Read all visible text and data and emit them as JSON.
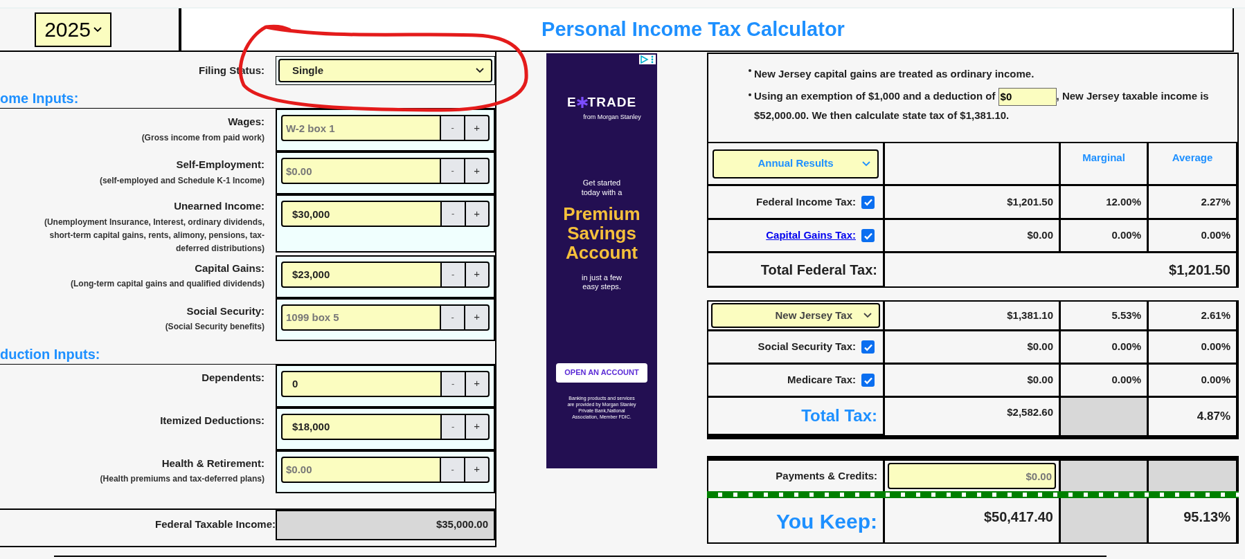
{
  "year_select": {
    "value": "2025"
  },
  "title": "Personal Income Tax Calculator",
  "filing_status": {
    "label": "Filing Status:",
    "value": "Single"
  },
  "sections": [
    {
      "heading": "ome Inputs:",
      "fields": [
        {
          "label": "Wages:",
          "sublabel": "(Gross income from paid work)",
          "placeholder": "W-2 box 1",
          "buttons": [
            "-",
            "+"
          ]
        },
        {
          "label": "Self-Employment:",
          "sublabel": "(self-employed and Schedule K-1 Income)",
          "placeholder": "$0.00",
          "buttons": [
            "-",
            "+"
          ]
        },
        {
          "label": "Unearned Income:",
          "sublabel": "(Unemployment Insurance, Interest, ordinary dividends, short-term capital gains, rents, alimony, pensions, tax-deferred distributions)",
          "value": "$30,000",
          "buttons": [
            "-",
            "+"
          ]
        },
        {
          "label": "Capital Gains:",
          "sublabel": "(Long-term capital gains and qualified dividends)",
          "value": "$23,000",
          "buttons": [
            "-",
            "+"
          ]
        },
        {
          "label": "Social Security:",
          "sublabel": "(Social Security benefits)",
          "placeholder": "1099 box 5",
          "buttons": [
            "-",
            "+"
          ]
        }
      ]
    },
    {
      "heading": "duction Inputs:",
      "fields": [
        {
          "label": "Dependents:",
          "value": "0",
          "buttons": [
            "-",
            "+"
          ]
        },
        {
          "label": "Itemized Deductions:",
          "value": "$18,000",
          "buttons": [
            "-",
            "+"
          ]
        },
        {
          "label": "Health & Retirement:",
          "sublabel": "(Health premiums and tax-deferred plans)",
          "placeholder": "$0.00",
          "buttons": [
            "-",
            "+"
          ]
        }
      ]
    }
  ],
  "federal_taxable_income": {
    "label": "Federal Taxable Income:",
    "value": "$35,000.00"
  },
  "ad": {
    "logo_start": "E",
    "logo_end": "TRADE",
    "logo_tagline": "from Morgan Stanley",
    "intro": "Get started today with a",
    "headline": "Premium Savings Account",
    "subline": "in just a few easy steps.",
    "button": "OPEN AN ACCOUNT",
    "disclaimer": "Banking products and services are provided by Morgan Stanley Private Bank,National Association, Member FDIC."
  },
  "notes": [
    {
      "text": "New Jersey capital gains are treated as ordinary income."
    },
    {
      "text": "Using an exemption of $1,000 and a deduction of",
      "input_value": "$0",
      "after": ", New Jersey taxable income is $52,000.00. We then calculate state tax of $1,381.10."
    }
  ],
  "results_select": "Annual Results",
  "columns": [
    "Marginal",
    "Average"
  ],
  "federal_rows": [
    {
      "kind": "checkbox",
      "label": "Federal Income Tax:",
      "checked": true,
      "amount": "$1,201.50",
      "marginal": "12.00%",
      "average": "2.27%"
    },
    {
      "kind": "link",
      "label": "Capital Gains Tax:",
      "checked": true,
      "amount": "$0.00",
      "marginal": "0.00%",
      "average": "0.00%"
    }
  ],
  "total_federal": {
    "label": "Total Federal Tax:",
    "value": "$1,201.50"
  },
  "state_rows": [
    {
      "kind": "select",
      "label": "New Jersey Tax",
      "amount": "$1,381.10",
      "marginal": "5.53%",
      "average": "2.61%"
    },
    {
      "kind": "checkbox",
      "label": "Social Security Tax:",
      "checked": true,
      "amount": "$0.00",
      "marginal": "0.00%",
      "average": "0.00%"
    },
    {
      "kind": "checkbox",
      "label": "Medicare Tax:",
      "checked": true,
      "amount": "$0.00",
      "marginal": "0.00%",
      "average": "0.00%"
    }
  ],
  "total_tax": {
    "label": "Total Tax:",
    "amount": "$2,582.60",
    "average": "4.87%"
  },
  "payments": {
    "label": "Payments & Credits:",
    "placeholder": "$0.00"
  },
  "you_keep": {
    "label": "You Keep:",
    "amount": "$50,417.40",
    "average": "95.13%"
  }
}
